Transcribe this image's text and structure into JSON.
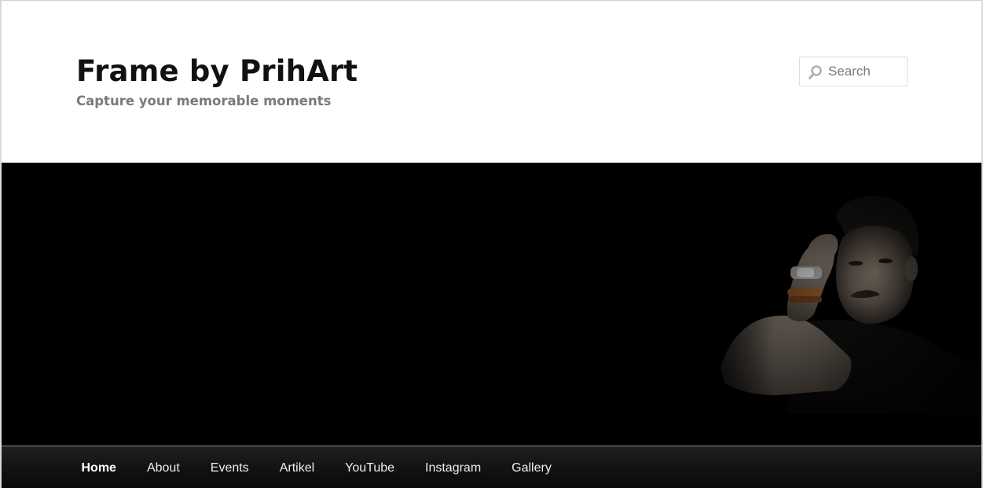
{
  "site": {
    "title": "Frame by PrihArt",
    "description": "Capture your memorable moments"
  },
  "search": {
    "placeholder": "Search",
    "value": ""
  },
  "banner": {
    "icon": "portrait-photo",
    "background_color": "#000000"
  },
  "nav": {
    "items": [
      {
        "label": "Home",
        "current": true
      },
      {
        "label": "About",
        "current": false
      },
      {
        "label": "Events",
        "current": false
      },
      {
        "label": "Artikel",
        "current": false
      },
      {
        "label": "YouTube",
        "current": false
      },
      {
        "label": "Instagram",
        "current": false
      },
      {
        "label": "Gallery",
        "current": false
      }
    ],
    "background_color": "#141414",
    "text_color": "#eeeeee"
  },
  "colors": {
    "title": "#111111",
    "description": "#7a7a7a",
    "search_border": "#dddddd"
  }
}
